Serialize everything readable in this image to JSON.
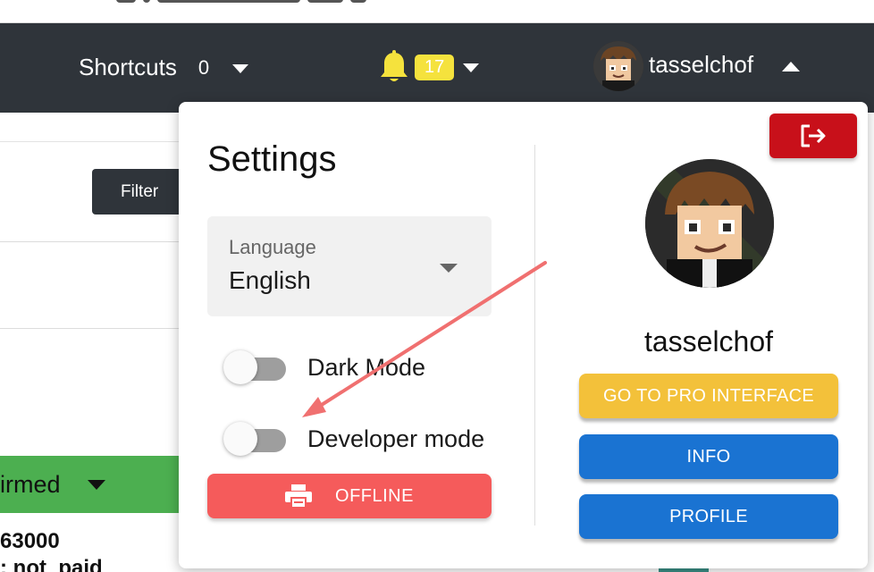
{
  "navbar": {
    "shortcuts_label": "Shortcuts",
    "shortcuts_count": "0",
    "notifications_count": "17",
    "username": "tasselchof"
  },
  "background": {
    "filter_label": "Filter",
    "status_label": "irmed",
    "id_text": "63000",
    "payment_text": ": not_paid"
  },
  "settings": {
    "title": "Settings",
    "language_label": "Language",
    "language_value": "English",
    "dark_mode_label": "Dark Mode",
    "dark_mode_on": false,
    "developer_mode_label": "Developer mode",
    "developer_mode_on": false,
    "offline_label": "OFFLINE"
  },
  "profile": {
    "name": "tasselchof",
    "pro_interface_label": "GO TO PRO INTERFACE",
    "info_label": "INFO",
    "profile_label": "PROFILE"
  },
  "colors": {
    "navbar_bg": "#2f343a",
    "badge": "#f5e23d",
    "logout": "#c8101a",
    "offline": "#f55b5b",
    "pro": "#f3c13a",
    "primary": "#1a73d2",
    "status_green": "#4caf50",
    "annotation_arrow": "#f07070"
  }
}
